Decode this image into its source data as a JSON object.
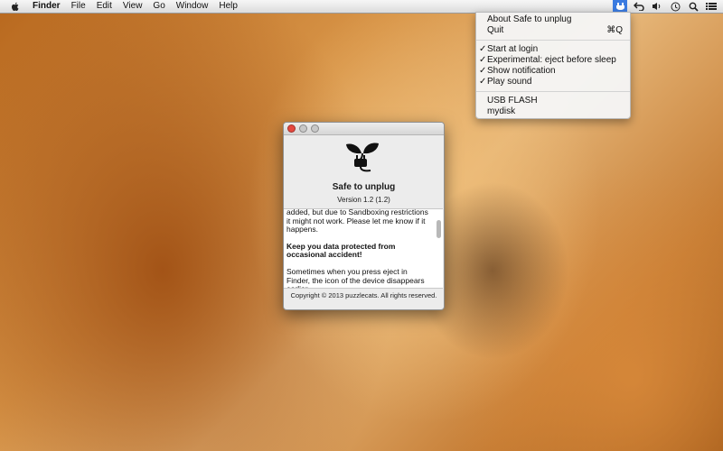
{
  "menubar": {
    "app_name": "Finder",
    "items": [
      "File",
      "Edit",
      "View",
      "Go",
      "Window",
      "Help"
    ],
    "status_icons": [
      "safe-to-unplug-icon",
      "time-machine-icon",
      "volume-icon",
      "clock-icon",
      "spotlight-search-icon",
      "notification-list-icon"
    ]
  },
  "dropdown": {
    "about_label": "About Safe to unplug",
    "quit_label": "Quit",
    "quit_shortcut": "⌘Q",
    "start_at_login": "Start at login",
    "experimental": "Experimental: eject before sleep",
    "show_notification": "Show notification",
    "play_sound": "Play sound",
    "disk1": "USB FLASH",
    "disk2": "mydisk"
  },
  "about_window": {
    "app_name": "Safe to unplug",
    "version": "Version 1.2 (1.2)",
    "text_para1": "added, but due to Sandboxing restrictions it might not work. Please let me know if it happens.",
    "text_heading": "Keep you data protected from occasional accident!",
    "text_para2": "Sometimes when you press eject in Finder, the icon of the device disappears earlier",
    "copyright": "Copyright © 2013 puzzlecats. All rights reserved."
  },
  "colors": {
    "menubar_bg": "#e8e8e8",
    "active_status_bg": "#3b7be0",
    "close_button": "#e6483f"
  }
}
